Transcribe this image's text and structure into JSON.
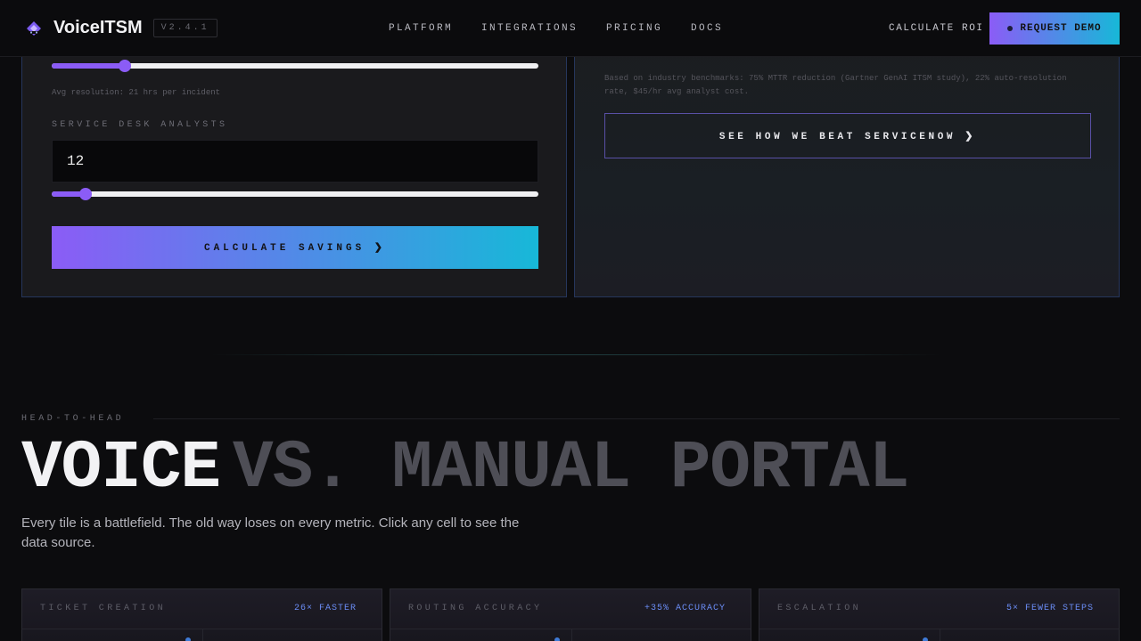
{
  "nav": {
    "brand": "VoiceITSM",
    "version": "V2.4.1",
    "links": [
      "PLATFORM",
      "INTEGRATIONS",
      "PRICING",
      "DOCS"
    ],
    "roi": "CALCULATE ROI",
    "demo": "REQUEST DEMO"
  },
  "calculator": {
    "resolution_hint": "Avg resolution: 21 hrs per incident",
    "resolution_slider_level": 0.15,
    "analysts_label": "SERVICE DESK ANALYSTS",
    "analysts_value": "12",
    "analysts_slider_level": 0.07,
    "calculate_button": "CALCULATE SAVINGS ❯"
  },
  "results": {
    "benchmark_note": "Based on industry benchmarks: 75% MTTR reduction (Gartner GenAI ITSM study), 22% auto-resolution rate, $45/hr avg analyst cost.",
    "beat_button": "SEE HOW WE BEAT SERVICENOW ❯"
  },
  "comparison": {
    "eyebrow": "HEAD-TO-HEAD",
    "headline_primary": "VOICE",
    "headline_secondary": "VS. MANUAL PORTAL",
    "description": "Every tile is a battlefield. The old way loses on every metric. Click any cell to see the data source.",
    "tiles": [
      {
        "name": "TICKET CREATION",
        "stat": "26× FASTER"
      },
      {
        "name": "ROUTING ACCURACY",
        "stat": "+35% ACCURACY"
      },
      {
        "name": "ESCALATION",
        "stat": "5× FEWER STEPS"
      }
    ]
  },
  "colors": {
    "accent_purple": "#8b5cf6",
    "accent_cyan": "#17b8d8",
    "stat_blue": "#6a8cf4"
  }
}
